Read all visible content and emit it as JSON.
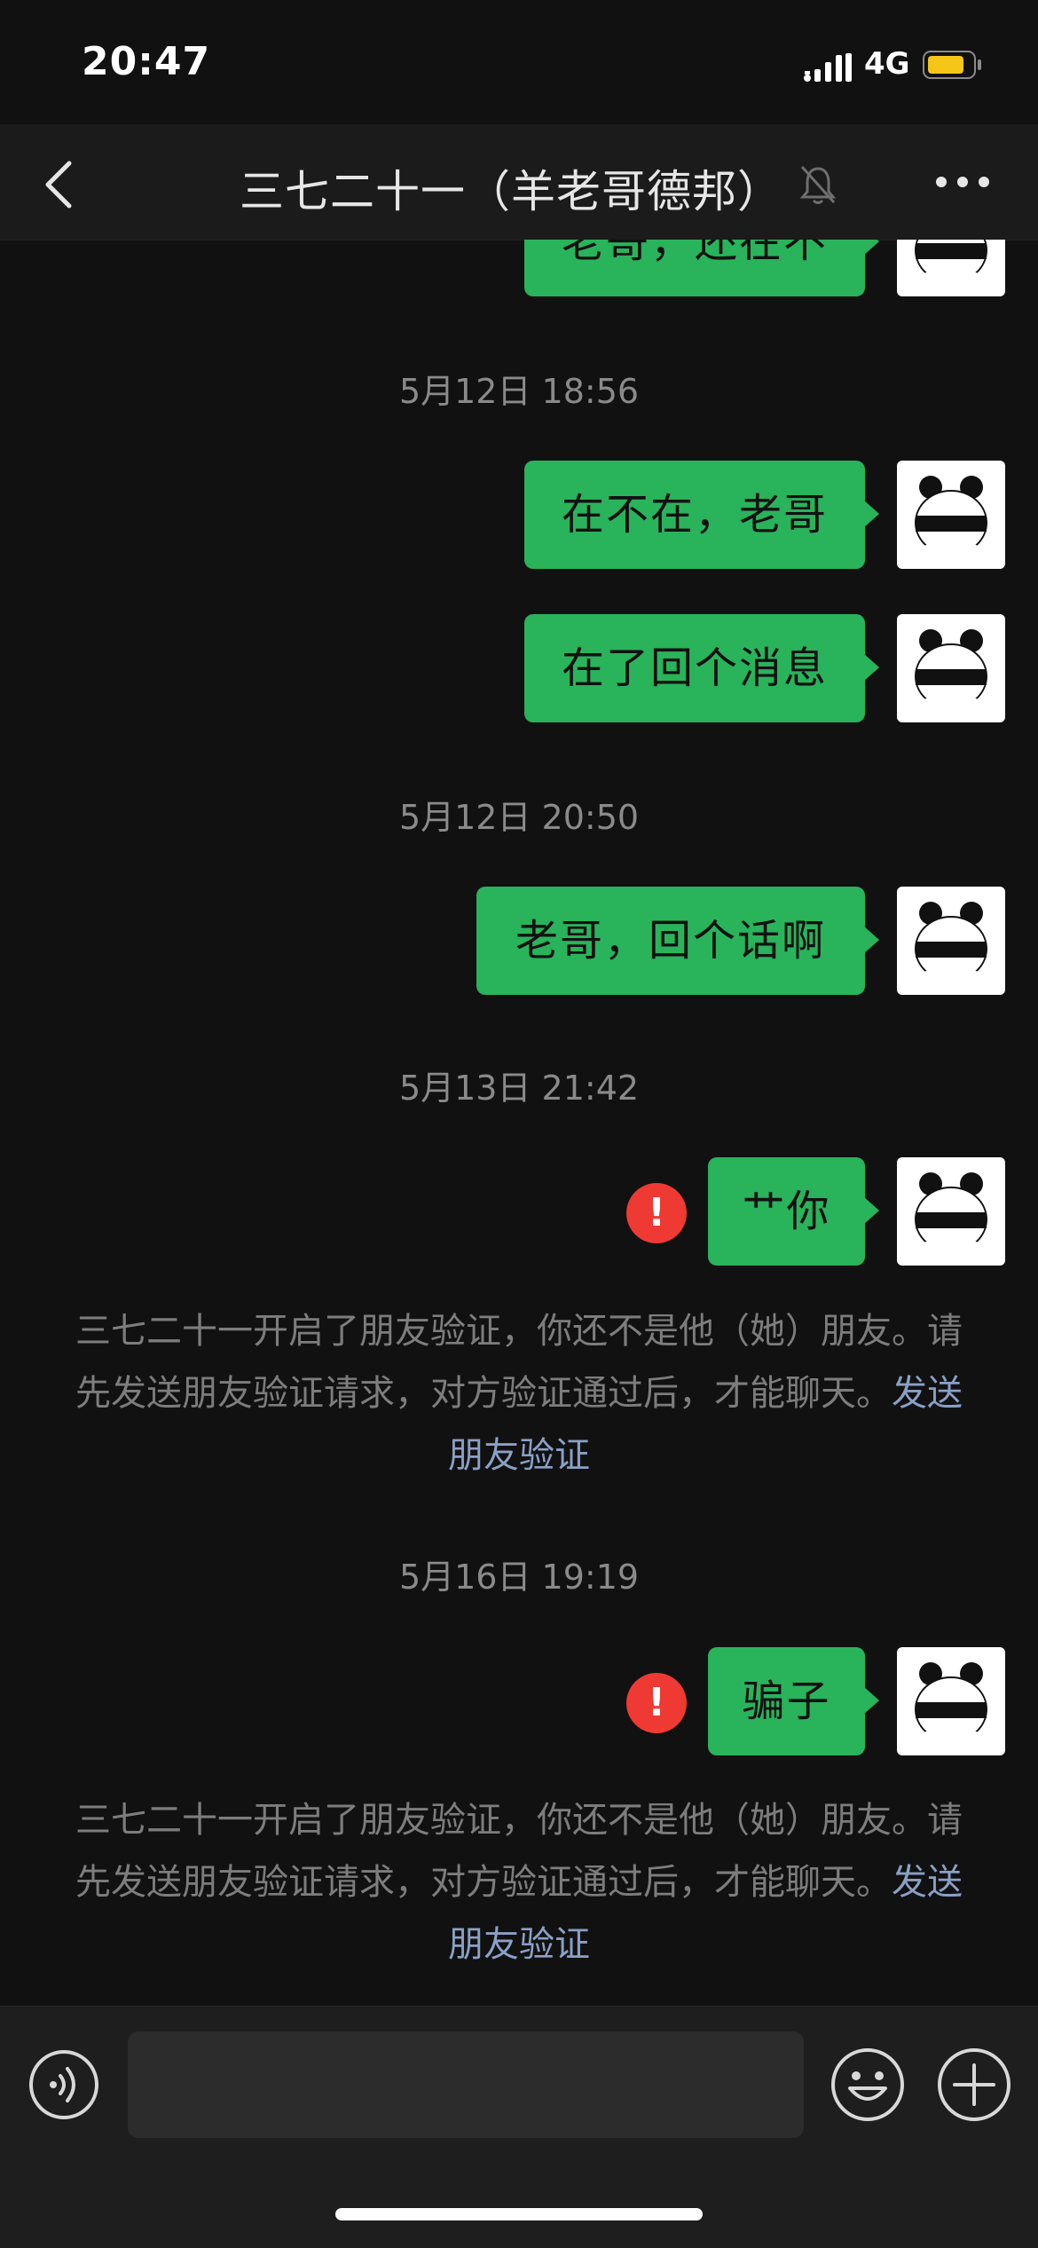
{
  "status_bar": {
    "time": "20:47",
    "network": "4G",
    "battery_color": "#f5c518"
  },
  "header": {
    "title": "三七二十一（羊老哥德邦）"
  },
  "messages": {
    "partial_text": "老哥，还在不",
    "time1": "5月12日 18:56",
    "msg1": "在不在，老哥",
    "msg2": "在了回个消息",
    "time2": "5月12日 20:50",
    "msg3": "老哥，回个话啊",
    "time3": "5月13日 21:42",
    "msg4": "艹你",
    "fail_icon": "!",
    "sys1_text": "三七二十一开启了朋友验证，你还不是他（她）朋友。请先发送朋友验证请求，对方验证通过后，才能聊天。",
    "sys1_link": "发送朋友验证",
    "time4": "5月16日 19:19",
    "msg5": "骗子",
    "sys2_text": "三七二十一开启了朋友验证，你还不是他（她）朋友。请先发送朋友验证请求，对方验证通过后，才能聊天。",
    "sys2_link": "发送朋友验证"
  },
  "colors": {
    "bubble": "#29b35b",
    "fail": "#ee3a33",
    "link": "#8aa0c6"
  },
  "icons": [
    "back-arrow-icon",
    "mute-bell-icon",
    "more-icon",
    "voice-icon",
    "emoji-icon",
    "plus-icon",
    "panda-avatar"
  ]
}
